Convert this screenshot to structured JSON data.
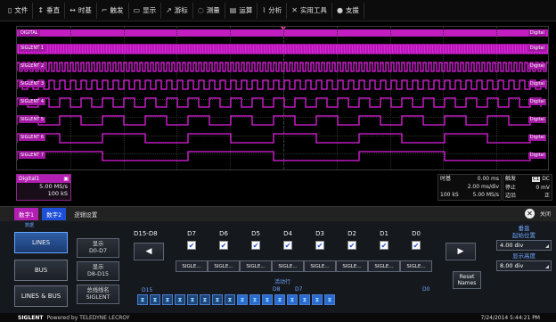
{
  "menu": [
    {
      "icon": "file-icon",
      "glyph": "▯",
      "label": "文件"
    },
    {
      "icon": "vertical-icon",
      "glyph": "↕",
      "label": "垂直"
    },
    {
      "icon": "timebase-icon",
      "glyph": "↔",
      "label": "时基"
    },
    {
      "icon": "trigger-icon",
      "glyph": "⌐",
      "label": "触发"
    },
    {
      "icon": "display-icon",
      "glyph": "▭",
      "label": "显示"
    },
    {
      "icon": "cursor-icon",
      "glyph": "↗",
      "label": "游标"
    },
    {
      "icon": "measure-icon",
      "glyph": "◌",
      "label": "测量"
    },
    {
      "icon": "math-icon",
      "glyph": "▤",
      "label": "运算"
    },
    {
      "icon": "analysis-icon",
      "glyph": "⌇",
      "label": "分析"
    },
    {
      "icon": "utility-icon",
      "glyph": "✕",
      "label": "实用工具"
    },
    {
      "icon": "help-icon",
      "glyph": "●",
      "label": "支援"
    }
  ],
  "waveforms": {
    "bus_label": "DIGITAL",
    "bus_end": "Digital",
    "end_label": "Digital",
    "channels": [
      "SIGLENT 1",
      "SIGLENT 2",
      "SIGLENT 3",
      "SIGLENT 4",
      "SIGLENT 5",
      "SIGLENT 6",
      "SIGLENT 7"
    ]
  },
  "digital_box": {
    "title": "Digital1",
    "sample_rate": "5.00 MS/s",
    "points": "100 kS"
  },
  "timebase": {
    "title": "时基",
    "delay": "0.00 ms",
    "scale": "2.00 ms/div",
    "points": "100 kS",
    "rate": "5.00 MS/s"
  },
  "trigger": {
    "title": "触发",
    "source": "C1",
    "coupling": "DC",
    "state": "停止",
    "level": "0 mV",
    "edge_label": "边沿",
    "slope": "正"
  },
  "tabs": [
    "数字1",
    "数字2",
    "逻辑设置"
  ],
  "close_label": "关闭",
  "panel": {
    "top_mini": "数据",
    "lines": "LINES",
    "bus": "BUS",
    "lines_bus": "LINES & BUS",
    "show1_a": "显示",
    "show1_b": "D0-D7",
    "show2_a": "显示",
    "show2_b": "D8-D15",
    "busname_a": "总线线名",
    "busname_b": "SIGLENT",
    "range": "D15-D8",
    "left_arrow": "◀",
    "right_arrow": "▶",
    "cols": [
      "D7",
      "D6",
      "D5",
      "D4",
      "D3",
      "D2",
      "D1",
      "D0"
    ],
    "names": [
      "SIGLE...",
      "SIGLE...",
      "SIGLE...",
      "SIGLE...",
      "SIGLE...",
      "SIGLE...",
      "SIGLE...",
      "SIGLE..."
    ],
    "active_row": "活动行",
    "mk_d15": "D15",
    "mk_d8": "D8",
    "mk_d7": "D7",
    "mk_d0": "D0",
    "reset_a": "Reset",
    "reset_b": "Names",
    "vertical_title": "垂直",
    "start_label": "起始位置",
    "start_value": "4.00 div",
    "height_label": "显示高度",
    "height_value": "8.00 div"
  },
  "footer": {
    "brand": "SIGLENT",
    "powered": "Powered by TELEDYNE LECROY",
    "datetime": "7/24/2014 5:44:21 PM"
  },
  "colors": {
    "waveform": "#e020e0",
    "bus": "#c11dc1",
    "accent_blue": "#1d4fd8"
  }
}
